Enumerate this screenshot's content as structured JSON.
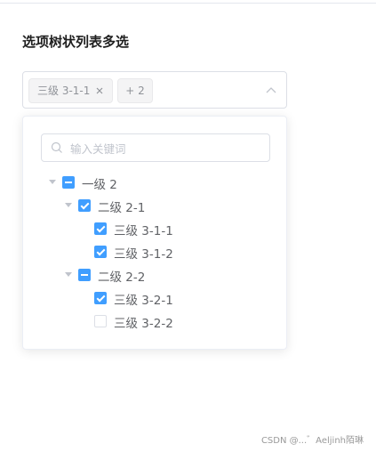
{
  "page": {
    "title": "选项树状列表多选"
  },
  "select": {
    "tags": [
      {
        "label": "三级 3-1-1"
      },
      {
        "label": "+ 2"
      }
    ]
  },
  "dropdown": {
    "filter_placeholder": "输入关键词",
    "tree": [
      {
        "label": "一级 2",
        "state": "indeterminate",
        "expanded": true
      },
      {
        "label": "二级 2-1",
        "state": "checked",
        "expanded": true
      },
      {
        "label": "三级 3-1-1",
        "state": "checked"
      },
      {
        "label": "三级 3-1-2",
        "state": "checked"
      },
      {
        "label": "二级 2-2",
        "state": "indeterminate",
        "expanded": true
      },
      {
        "label": "三级 3-2-1",
        "state": "checked"
      },
      {
        "label": "三级 3-2-2",
        "state": "unchecked"
      }
    ]
  },
  "watermark": "CSDN @...゛Aeljinh陌琳",
  "colors": {
    "primary": "#409eff",
    "border": "#dcdfe6",
    "text": "#606266"
  }
}
